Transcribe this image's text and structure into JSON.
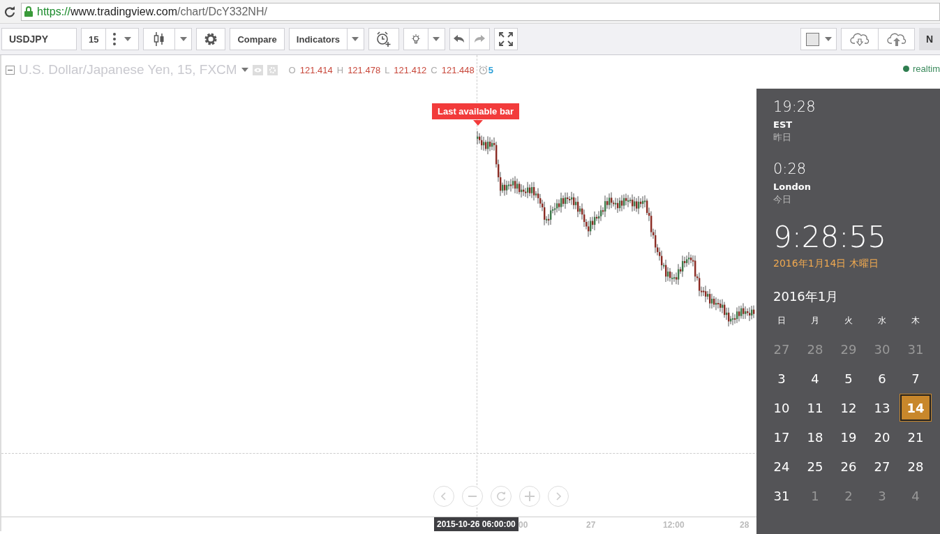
{
  "browser": {
    "url_scheme": "https://",
    "url_host": "www.tradingview.com",
    "url_path": "/chart/DcY332NH/"
  },
  "toolbar": {
    "symbol": "USDJPY",
    "interval": "15",
    "compare": "Compare",
    "indicators": "Indicators",
    "tab_partial": "N"
  },
  "legend": {
    "title": "U.S. Dollar/Japanese Yen, 15, FXCM",
    "ohlc": [
      {
        "label": "O",
        "value": "121.414"
      },
      {
        "label": "H",
        "value": "121.478"
      },
      {
        "label": "L",
        "value": "121.412"
      },
      {
        "label": "C",
        "value": "121.448"
      }
    ],
    "alerts": "5",
    "status": "realtim"
  },
  "chart": {
    "marker": "Last available bar",
    "crosshair_time": "2015-10-26 06:00:00",
    "time_labels": [
      "00",
      "27",
      "12:00",
      "28"
    ]
  },
  "clock": {
    "clocks": [
      {
        "time": "19:28",
        "zone": "EST",
        "day": "昨日"
      },
      {
        "time": "0:28",
        "zone": "London",
        "day": "今日"
      }
    ],
    "time": "9:28:55",
    "date": "2016年1月14日 木曜日",
    "month": "2016年1月",
    "weekdays": [
      "日",
      "月",
      "火",
      "水",
      "木"
    ],
    "weeks": [
      [
        {
          "day": "27",
          "in_month": false,
          "selected": false
        },
        {
          "day": "28",
          "in_month": false,
          "selected": false
        },
        {
          "day": "29",
          "in_month": false,
          "selected": false
        },
        {
          "day": "30",
          "in_month": false,
          "selected": false
        },
        {
          "day": "31",
          "in_month": false,
          "selected": false
        }
      ],
      [
        {
          "day": "3",
          "in_month": true,
          "selected": false
        },
        {
          "day": "4",
          "in_month": true,
          "selected": false
        },
        {
          "day": "5",
          "in_month": true,
          "selected": false
        },
        {
          "day": "6",
          "in_month": true,
          "selected": false
        },
        {
          "day": "7",
          "in_month": true,
          "selected": false
        }
      ],
      [
        {
          "day": "10",
          "in_month": true,
          "selected": false
        },
        {
          "day": "11",
          "in_month": true,
          "selected": false
        },
        {
          "day": "12",
          "in_month": true,
          "selected": false
        },
        {
          "day": "13",
          "in_month": true,
          "selected": false
        },
        {
          "day": "14",
          "in_month": true,
          "selected": true
        }
      ],
      [
        {
          "day": "17",
          "in_month": true,
          "selected": false
        },
        {
          "day": "18",
          "in_month": true,
          "selected": false
        },
        {
          "day": "19",
          "in_month": true,
          "selected": false
        },
        {
          "day": "20",
          "in_month": true,
          "selected": false
        },
        {
          "day": "21",
          "in_month": true,
          "selected": false
        }
      ],
      [
        {
          "day": "24",
          "in_month": true,
          "selected": false
        },
        {
          "day": "25",
          "in_month": true,
          "selected": false
        },
        {
          "day": "26",
          "in_month": true,
          "selected": false
        },
        {
          "day": "27",
          "in_month": true,
          "selected": false
        },
        {
          "day": "28",
          "in_month": true,
          "selected": false
        }
      ],
      [
        {
          "day": "31",
          "in_month": true,
          "selected": false
        },
        {
          "day": "1",
          "in_month": false,
          "selected": false
        },
        {
          "day": "2",
          "in_month": false,
          "selected": false
        },
        {
          "day": "3",
          "in_month": false,
          "selected": false
        },
        {
          "day": "4",
          "in_month": false,
          "selected": false
        }
      ]
    ]
  }
}
